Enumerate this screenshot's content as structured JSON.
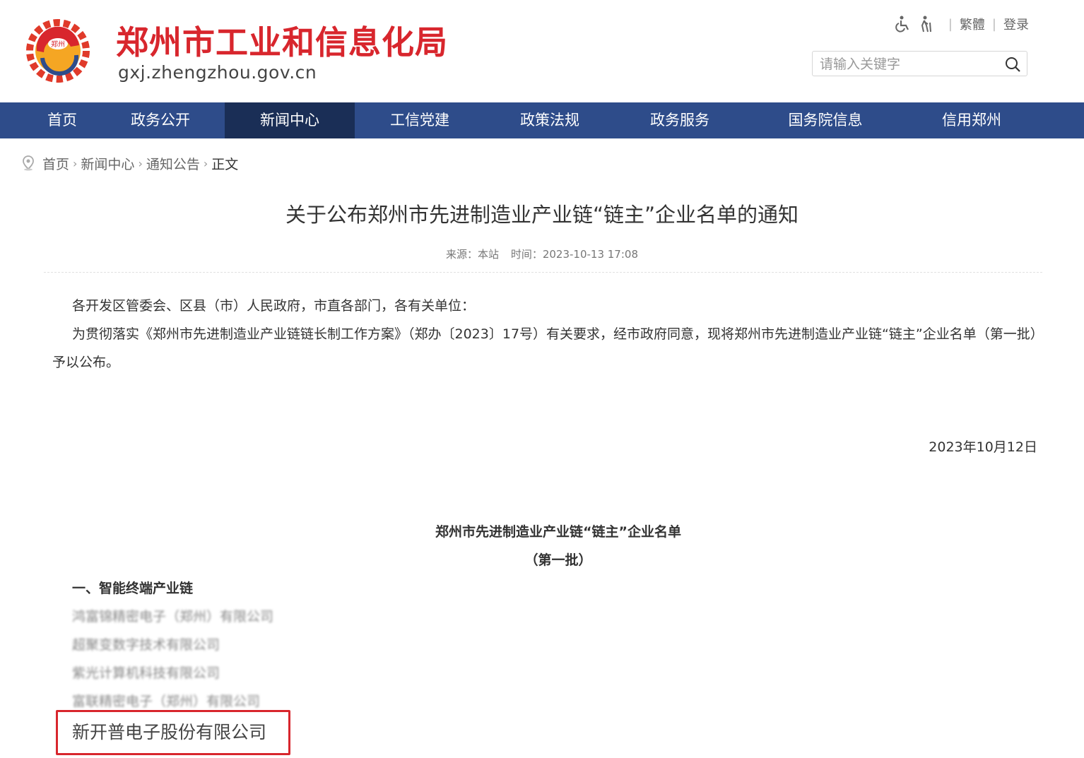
{
  "header": {
    "site_title": "郑州市工业和信息化局",
    "site_domain": "gxj.zhengzhou.gov.cn",
    "emblem_text": "郑州",
    "tools": {
      "traditional": "繁體",
      "login": "登录"
    },
    "search": {
      "placeholder": "请输入关键字"
    }
  },
  "nav": {
    "items": [
      {
        "label": "首页"
      },
      {
        "label": "政务公开"
      },
      {
        "label": "新闻中心"
      },
      {
        "label": "工信党建"
      },
      {
        "label": "政策法规"
      },
      {
        "label": "政务服务"
      },
      {
        "label": "国务院信息"
      },
      {
        "label": "信用郑州"
      }
    ],
    "active_index": 2
  },
  "breadcrumb": {
    "items": [
      "首页",
      "新闻中心",
      "通知公告"
    ],
    "current": "正文"
  },
  "article": {
    "title": "关于公布郑州市先进制造业产业链“链主”企业名单的通知",
    "source": "来源：本站",
    "time": "时间：2023-10-13 17:08",
    "salutation": "各开发区管委会、区县（市）人民政府，市直各部门，各有关单位：",
    "body": "为贯彻落实《郑州市先进制造业产业链链长制工作方案》（郑办〔2023〕17号）有关要求，经市政府同意，现将郑州市先进制造业产业链“链主”企业名单（第一批）予以公布。",
    "date": "2023年10月12日",
    "list_title": "郑州市先进制造业产业链“链主”企业名单",
    "list_subtitle": "（第一批）",
    "section_1": "一、智能终端产业链",
    "companies": [
      "鸿富锦精密电子（郑州）有限公司",
      "超聚变数字技术有限公司",
      "紫光计算机科技有限公司",
      "富联精密电子（郑州）有限公司"
    ],
    "highlighted_company": "新开普电子股份有限公司"
  },
  "colors": {
    "brand_red": "#d8262d",
    "nav_bg": "#2e4c8a",
    "nav_active_bg": "#1a2e56"
  }
}
